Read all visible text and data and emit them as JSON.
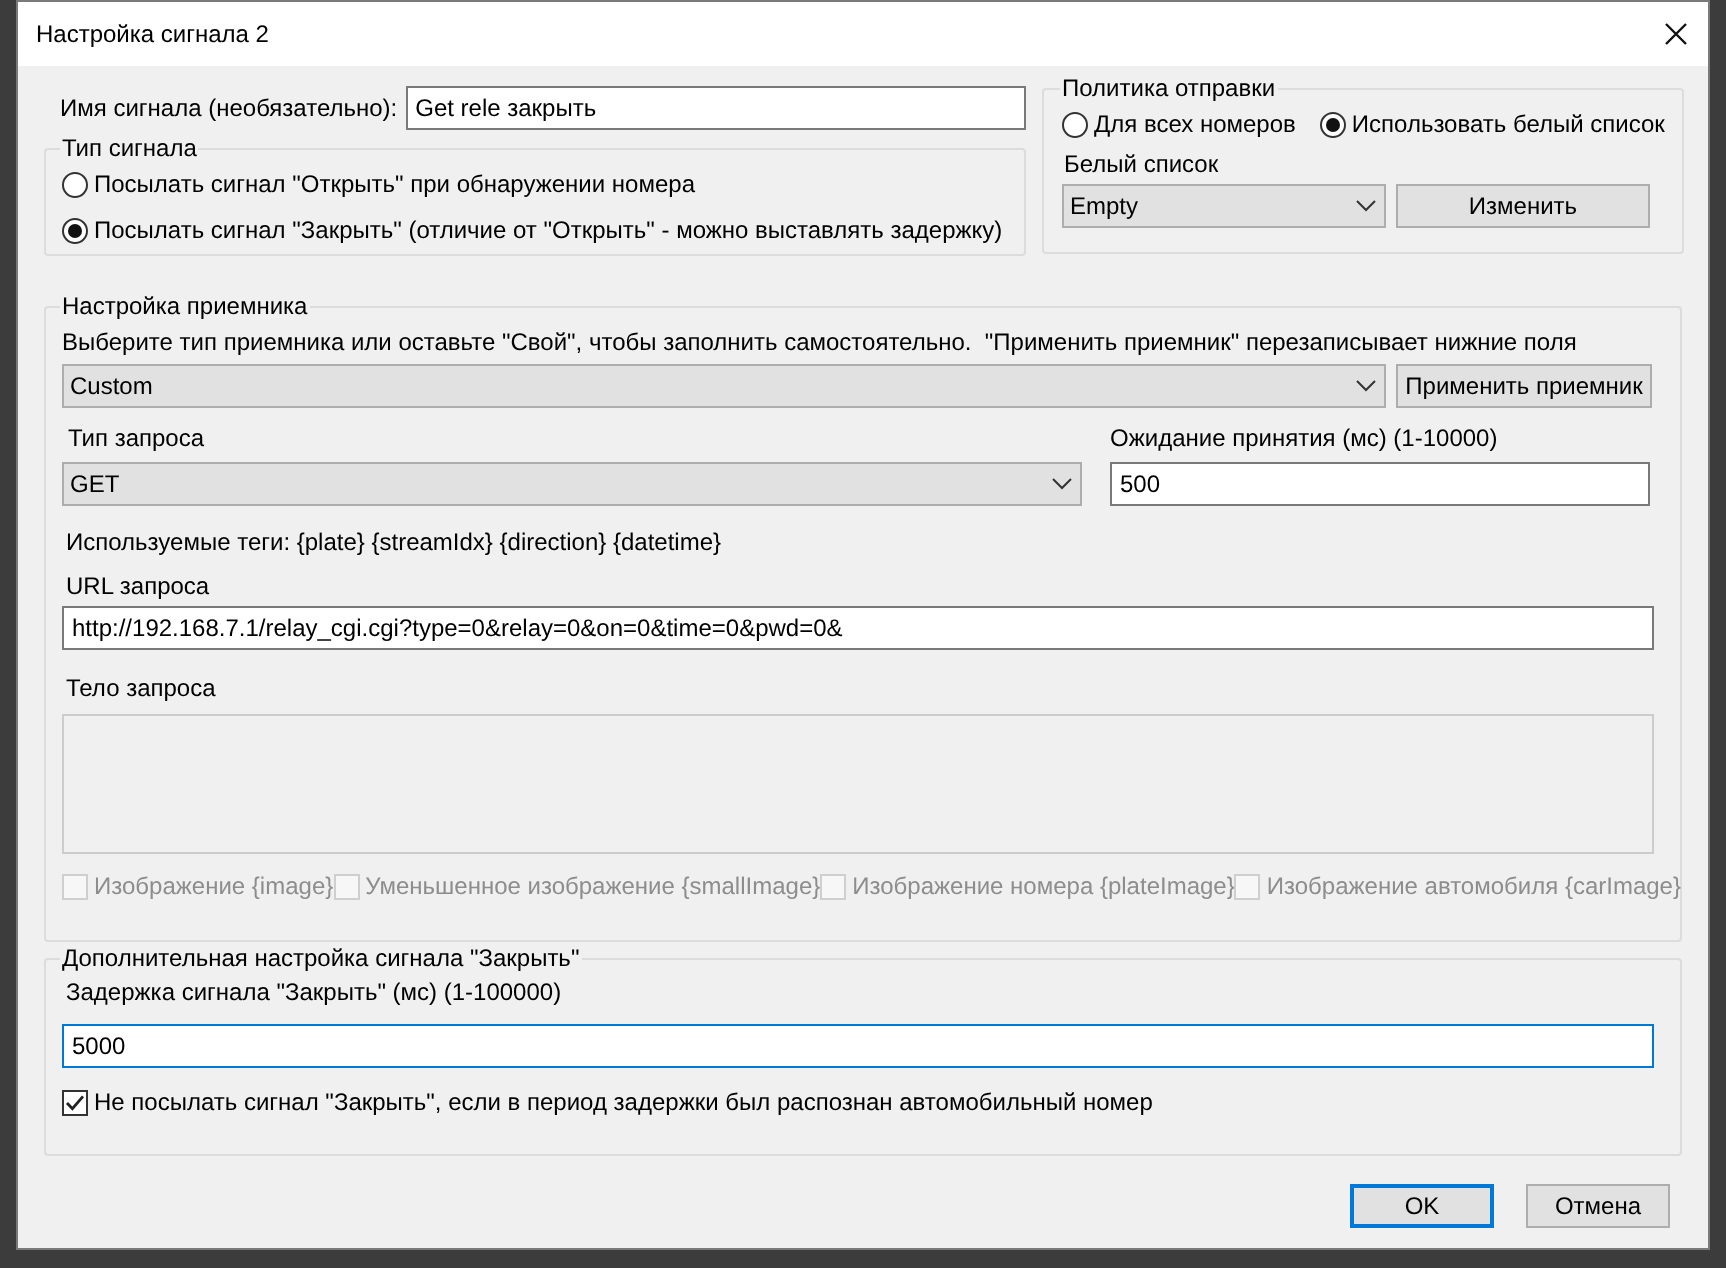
{
  "window": {
    "title": "Настройка сигнала 2"
  },
  "signal_name": {
    "label": "Имя сигнала (необязательно):",
    "value": "Get rele закрыть"
  },
  "signal_type": {
    "title": "Тип сигнала",
    "options": [
      {
        "label": "Посылать сигнал \"Открыть\" при обнаружении номера",
        "selected": false
      },
      {
        "label": "Посылать сигнал \"Закрыть\" (отличие от \"Открыть\" - можно выставлять задержку)",
        "selected": true
      }
    ]
  },
  "send_policy": {
    "title": "Политика отправки",
    "options": [
      {
        "label": "Для всех номеров",
        "selected": false
      },
      {
        "label": "Использовать белый список",
        "selected": true
      }
    ],
    "whitelist_label": "Белый список",
    "whitelist_value": "Empty",
    "edit_button": "Изменить"
  },
  "receiver": {
    "title": "Настройка приемника",
    "hint": "Выберите тип приемника или оставьте \"Свой\", чтобы заполнить самостоятельно.  \"Применить приемник\" перезаписывает нижние поля",
    "receiver_type": "Custom",
    "apply_button": "Применить приемник",
    "request_type_label": "Тип запроса",
    "request_type": "GET",
    "timeout_label": "Ожидание принятия (мс) (1-10000)",
    "timeout_value": "500",
    "tags_text": "Используемые теги: {plate} {streamIdx} {direction} {datetime}",
    "url_label": "URL запроса",
    "url_value": "http://192.168.7.1/relay_cgi.cgi?type=0&relay=0&on=0&time=0&pwd=0&",
    "body_label": "Тело запроса",
    "body_disabled": true,
    "attachments": [
      {
        "label": "Изображение {image}",
        "checked": false,
        "disabled": true
      },
      {
        "label": "Уменьшенное изображение {smallImage}",
        "checked": false,
        "disabled": true
      },
      {
        "label": "Изображение номера {plateImage}",
        "checked": false,
        "disabled": true
      },
      {
        "label": "Изображение автомобиля {carImage}",
        "checked": false,
        "disabled": true
      }
    ]
  },
  "close_settings": {
    "title": "Дополнительная настройка сигнала \"Закрыть\"",
    "delay_label": "Задержка сигнала \"Закрыть\" (мс) (1-100000)",
    "delay_value": "5000",
    "suppress": {
      "label": "Не посылать сигнал \"Закрыть\", если в период задержки был распознан автомобильный номер",
      "checked": true
    }
  },
  "buttons": [
    {
      "label": "OK",
      "default": true
    },
    {
      "label": "Отмена",
      "default": false
    }
  ]
}
